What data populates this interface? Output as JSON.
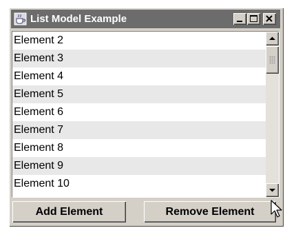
{
  "window": {
    "title": "List Model Example",
    "controls": [
      "minimize",
      "maximize",
      "close"
    ]
  },
  "list": {
    "items": [
      "Element 2",
      "Element 3",
      "Element 4",
      "Element 5",
      "Element 6",
      "Element 7",
      "Element 8",
      "Element 9",
      "Element 10"
    ]
  },
  "buttons": {
    "add_label": "Add Element",
    "remove_label": "Remove Element"
  },
  "icons": {
    "app": "java-cup-icon",
    "scroll_up": "arrow-up-icon",
    "scroll_down": "arrow-down-icon",
    "cursor": "mouse-pointer-icon"
  },
  "colors": {
    "titlebar": "#6c6c6c",
    "window_face": "#d4d0c8",
    "row_alternate": "#e8e8e8"
  }
}
